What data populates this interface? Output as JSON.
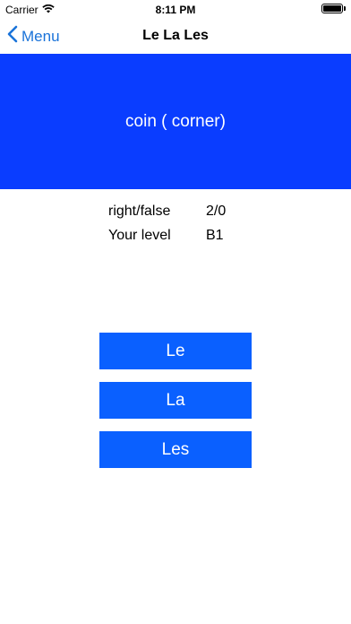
{
  "status_bar": {
    "carrier": "Carrier",
    "time": "8:11 PM",
    "wifi_icon": "wifi-icon",
    "battery_icon": "battery-icon"
  },
  "nav": {
    "back_label": "Menu",
    "back_icon": "chevron-left-icon",
    "title": "Le La Les"
  },
  "word": {
    "text": "coin ( corner)"
  },
  "stats": {
    "score_label": "right/false",
    "score_value": "2/0",
    "level_label": "Your level",
    "level_value": "B1"
  },
  "answers": [
    {
      "label": "Le"
    },
    {
      "label": "La"
    },
    {
      "label": "Les"
    }
  ],
  "colors": {
    "banner": "#0a3dff",
    "button": "#0a60ff",
    "accent": "#1a73d9"
  }
}
